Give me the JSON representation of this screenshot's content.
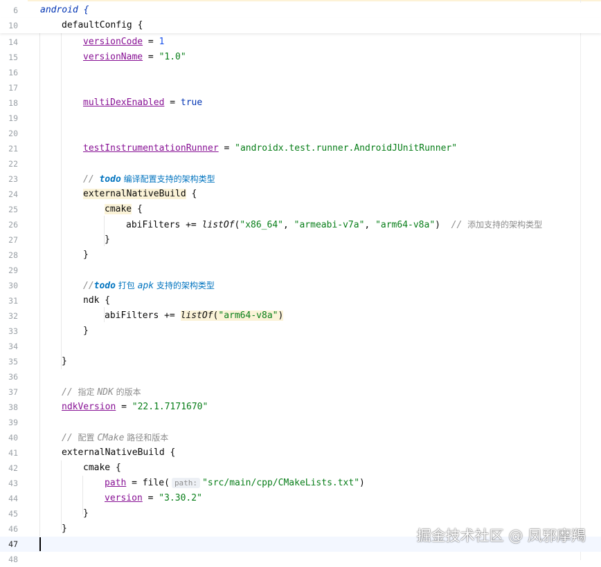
{
  "editor": {
    "sticky_lines": [
      {
        "num": "6",
        "text": "android {"
      },
      {
        "num": "10",
        "text": "defaultConfig {"
      }
    ],
    "lines": [
      {
        "num": "14",
        "tokens": [
          "versionCode",
          " = ",
          "1"
        ]
      },
      {
        "num": "15",
        "tokens": [
          "versionName",
          " = ",
          "\"1.0\""
        ]
      },
      {
        "num": "16"
      },
      {
        "num": "17"
      },
      {
        "num": "18",
        "tokens": [
          "multiDexEnabled",
          " = ",
          "true"
        ]
      },
      {
        "num": "19"
      },
      {
        "num": "20"
      },
      {
        "num": "21",
        "tokens": [
          "testInstrumentationRunner",
          " = ",
          "\"androidx.test.runner.AndroidJUnitRunner\""
        ]
      },
      {
        "num": "22"
      },
      {
        "num": "23",
        "tokens": [
          "// ",
          "todo",
          " 编译配置支持的架构类型"
        ]
      },
      {
        "num": "24",
        "tokens": [
          "externalNativeBuild",
          " {"
        ]
      },
      {
        "num": "25",
        "tokens": [
          "cmake",
          " {"
        ]
      },
      {
        "num": "26",
        "tokens": [
          "abiFilters += ",
          "listOf",
          "(",
          "\"x86_64\"",
          ", ",
          "\"armeabi-v7a\"",
          ", ",
          "\"arm64-v8a\"",
          ")  ",
          "// ",
          "添加支持的架构类型"
        ]
      },
      {
        "num": "27",
        "tokens": [
          "}"
        ]
      },
      {
        "num": "28",
        "tokens": [
          "}"
        ]
      },
      {
        "num": "29"
      },
      {
        "num": "30",
        "tokens": [
          "//",
          "todo",
          " 打包 ",
          "apk",
          " 支持的架构类型"
        ]
      },
      {
        "num": "31",
        "tokens": [
          "ndk {"
        ]
      },
      {
        "num": "32",
        "tokens": [
          "abiFilters += ",
          "listOf",
          "(",
          "\"arm64-v8a\"",
          ")"
        ]
      },
      {
        "num": "33",
        "tokens": [
          "}"
        ]
      },
      {
        "num": "34"
      },
      {
        "num": "35",
        "tokens": [
          "}"
        ]
      },
      {
        "num": "36"
      },
      {
        "num": "37",
        "tokens": [
          "// ",
          "指定 ",
          "NDK",
          " 的版本"
        ]
      },
      {
        "num": "38",
        "tokens": [
          "ndkVersion",
          " = ",
          "\"22.1.7171670\""
        ]
      },
      {
        "num": "39"
      },
      {
        "num": "40",
        "tokens": [
          "// ",
          "配置 ",
          "CMake",
          " 路径和版本"
        ]
      },
      {
        "num": "41",
        "tokens": [
          "externalNativeBuild {"
        ]
      },
      {
        "num": "42",
        "tokens": [
          "cmake {"
        ]
      },
      {
        "num": "43",
        "tokens": [
          "path",
          " = file(",
          "path:",
          "\"src/main/cpp/CMakeLists.txt\"",
          ")"
        ]
      },
      {
        "num": "44",
        "tokens": [
          "version",
          " = ",
          "\"3.30.2\""
        ]
      },
      {
        "num": "45",
        "tokens": [
          "}"
        ]
      },
      {
        "num": "46",
        "tokens": [
          "}"
        ]
      },
      {
        "num": "47"
      },
      {
        "num": "48"
      }
    ]
  },
  "watermark": "掘金技术社区 @ 凤邪摩羯"
}
